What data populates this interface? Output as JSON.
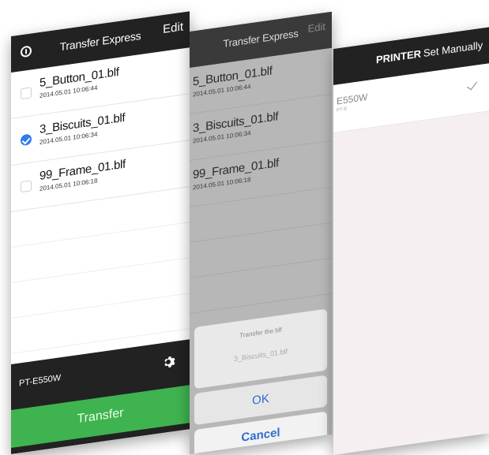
{
  "screen1": {
    "nav": {
      "title": "Transfer Express",
      "edit": "Edit"
    },
    "files": [
      {
        "name": "5_Button_01.blf",
        "date": "2014.05.01 10:06:44",
        "checked": false
      },
      {
        "name": "3_Biscuits_01.blf",
        "date": "2014.05.01 10:06:34",
        "checked": true
      },
      {
        "name": "99_Frame_01.blf",
        "date": "2014.05.01 10:06:18",
        "checked": false
      }
    ],
    "printer": "PT-E550W",
    "transfer_label": "Transfer"
  },
  "screen2": {
    "nav": {
      "title": "Transfer Express",
      "edit": "Edit"
    },
    "files": [
      {
        "name": "5_Button_01.blf",
        "date": "2014.05.01 10:06:44"
      },
      {
        "name": "3_Biscuits_01.blf",
        "date": "2014.05.01 10:06:34"
      },
      {
        "name": "99_Frame_01.blf",
        "date": "2014.05.01 10:06:18"
      }
    ],
    "sheet": {
      "title": "Transfer the blf",
      "file": "3_Biscuits_01.blf"
    },
    "ok_label": "OK",
    "cancel_label": "Cancel"
  },
  "screen3": {
    "tabs": {
      "printer": "PRINTER",
      "manual": "Set Manually"
    },
    "printer": {
      "name": "E550W",
      "sub": "PT-E"
    }
  },
  "colors": {
    "accent": "#2f7bf0",
    "transfer": "#3fb34f",
    "navbar": "#222222"
  }
}
